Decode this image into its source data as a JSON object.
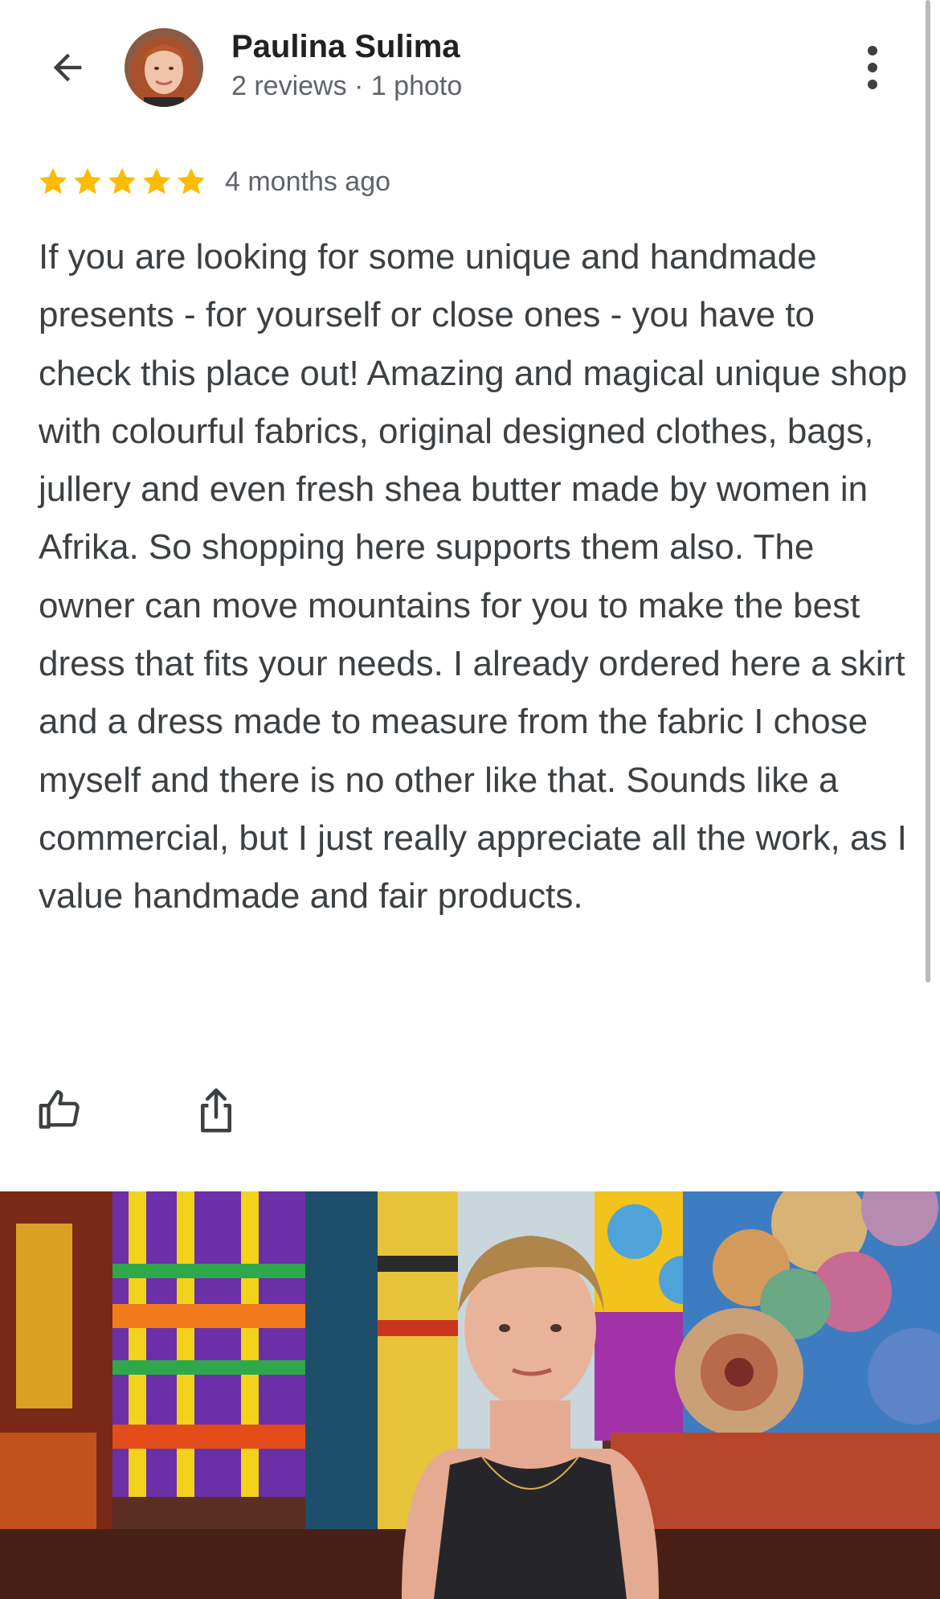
{
  "header": {
    "user_name": "Paulina Sulima",
    "user_meta": "2 reviews · 1 photo",
    "back_icon": "arrow-back-icon",
    "more_icon": "more-vert-icon"
  },
  "review": {
    "rating": 5,
    "max_rating": 5,
    "time_ago": "4 months ago",
    "text": "If you are looking for some unique and handmade presents - for yourself or close ones - you have to check this place out! Amazing and magical unique shop with colourful fabrics, original designed clothes, bags, jullery and even fresh shea butter made by women in Afrika. So shopping here supports them also. The owner can move mountains for you to make the best dress that fits your needs. I already ordered here a skirt and a dress made to measure from the fabric I chose myself and there is no other like that. Sounds like a commercial, but I just really appreciate all the work, as I value handmade and fair products."
  },
  "actions": {
    "like_icon": "thumb-up-icon",
    "share_icon": "share-icon"
  },
  "colors": {
    "star": "#fbbc04",
    "text": "#3c4043",
    "meta": "#5f6368",
    "name": "#202124"
  }
}
